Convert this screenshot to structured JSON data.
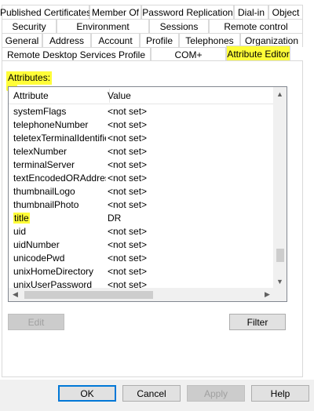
{
  "tabs": {
    "row1": [
      "Published Certificates",
      "Member Of",
      "Password Replication",
      "Dial-in",
      "Object"
    ],
    "row2": [
      "Security",
      "Environment",
      "Sessions",
      "Remote control"
    ],
    "row3": [
      "General",
      "Address",
      "Account",
      "Profile",
      "Telephones",
      "Organization"
    ],
    "row4": [
      "Remote Desktop Services Profile",
      "COM+",
      "Attribute Editor"
    ],
    "active": "Attribute Editor"
  },
  "attributes_label": "Attributes:",
  "list": {
    "columns": [
      "Attribute",
      "Value"
    ],
    "rows": [
      [
        "systemFlags",
        "<not set>"
      ],
      [
        "telephoneNumber",
        "<not set>"
      ],
      [
        "teletexTerminalIdentifier",
        "<not set>"
      ],
      [
        "telexNumber",
        "<not set>"
      ],
      [
        "terminalServer",
        "<not set>"
      ],
      [
        "textEncodedORAddress",
        "<not set>"
      ],
      [
        "thumbnailLogo",
        "<not set>"
      ],
      [
        "thumbnailPhoto",
        "<not set>"
      ],
      [
        "title",
        "DR"
      ],
      [
        "uid",
        "<not set>"
      ],
      [
        "uidNumber",
        "<not set>"
      ],
      [
        "unicodePwd",
        "<not set>"
      ],
      [
        "unixHomeDirectory",
        "<not set>"
      ],
      [
        "unixUserPassword",
        "<not set>"
      ]
    ],
    "highlighted_row": "title"
  },
  "buttons": {
    "edit": "Edit",
    "filter": "Filter",
    "ok": "OK",
    "cancel": "Cancel",
    "apply": "Apply",
    "help": "Help"
  },
  "colors": {
    "highlight": "#fffd38",
    "button_face": "#e1e1e1",
    "default_button_border": "#0078d7"
  }
}
